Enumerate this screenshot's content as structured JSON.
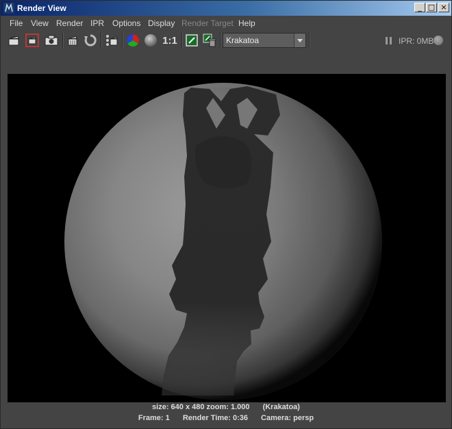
{
  "window": {
    "title": "Render View",
    "controls": {
      "minimize": "_",
      "maximize": "□",
      "close": "×"
    }
  },
  "menubar": {
    "items": [
      {
        "label": "File",
        "enabled": true
      },
      {
        "label": "View",
        "enabled": true
      },
      {
        "label": "Render",
        "enabled": true
      },
      {
        "label": "IPR",
        "enabled": true
      },
      {
        "label": "Options",
        "enabled": true
      },
      {
        "label": "Display",
        "enabled": true
      },
      {
        "label": "Render Target",
        "enabled": false
      },
      {
        "label": "Help",
        "enabled": true
      }
    ]
  },
  "toolbar": {
    "icons": [
      "render-clapper-icon",
      "render-region-icon",
      "snapshot-camera-icon",
      "ipr-render-icon",
      "refresh-ipr-icon",
      "render-sequence-icon",
      "rgb-channels-icon",
      "alpha-channel-icon",
      "real-size-icon",
      "keep-image-icon",
      "remove-image-icon"
    ],
    "real_size_label": "1:1",
    "renderer": {
      "selected": "Krakatoa"
    },
    "ipr_memory": "IPR: 0MB"
  },
  "status": {
    "size_line": "size: 640 x 480 zoom: 1.000",
    "renderer_label": "(Krakatoa)",
    "frame": "Frame: 1",
    "render_time": "Render Time: 0:36",
    "camera": "Camera: persp"
  },
  "colors": {
    "title_gradient_start": "#0a246a",
    "title_gradient_end": "#a6caf0",
    "ui_background": "#444444",
    "viewport_background": "#000000"
  }
}
